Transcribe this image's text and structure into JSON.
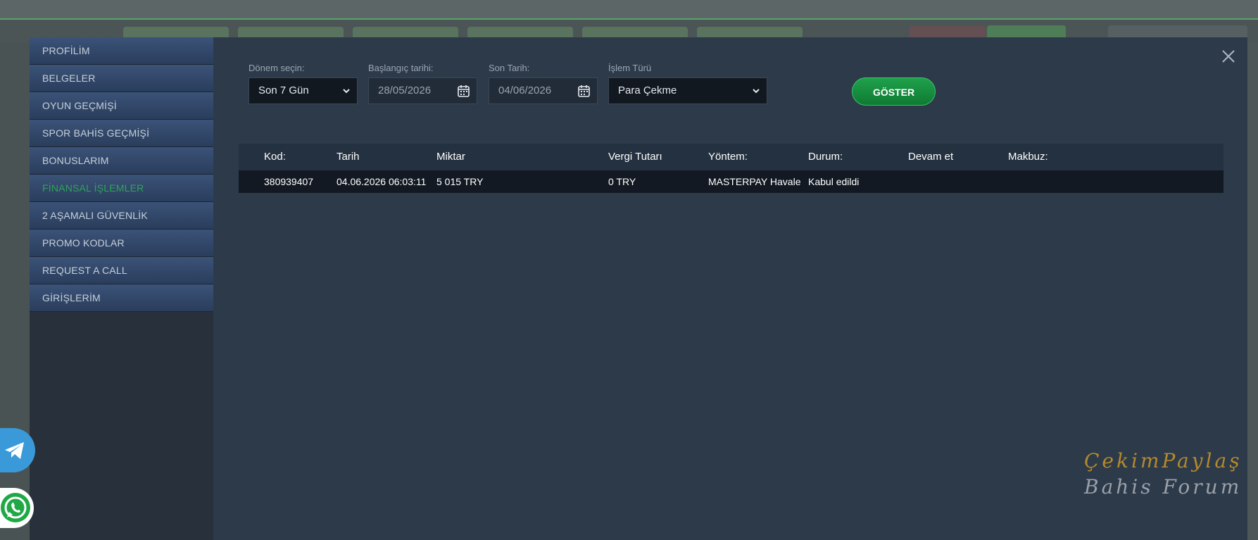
{
  "menu": {
    "items": [
      {
        "label": "PROFİLİM",
        "active": false
      },
      {
        "label": "BELGELER",
        "active": false
      },
      {
        "label": "OYUN GEÇMİŞİ",
        "active": false
      },
      {
        "label": "SPOR BAHİS GEÇMİŞİ",
        "active": false
      },
      {
        "label": "BONUSLARIM",
        "active": false
      },
      {
        "label": "FİNANSAL İŞLEMLER",
        "active": true
      },
      {
        "label": "2 AŞAMALI GÜVENLİK",
        "active": false
      },
      {
        "label": "PROMO KODLAR",
        "active": false
      },
      {
        "label": "REQUEST A CALL",
        "active": false
      },
      {
        "label": "GİRİŞLERİM",
        "active": false
      }
    ]
  },
  "filters": {
    "period_label": "Dönem seçin:",
    "period_value": "Son 7 Gün",
    "start_label": "Başlangıç tarihi:",
    "start_value": "28/05/2026",
    "end_label": "Son Tarih:",
    "end_value": "04/06/2026",
    "type_label": "İşlem Türü",
    "type_value": "Para Çekme",
    "show_button": "GÖSTER"
  },
  "table": {
    "headers": [
      "Kod:",
      "Tarih",
      "Miktar",
      "Vergi Tutarı",
      "Yöntem:",
      "Durum:",
      "Devam et",
      "Makbuz:"
    ],
    "rows": [
      [
        "380939407",
        "04.06.2026 06:03:11",
        "5 015 TRY",
        "0 TRY",
        "MASTERPAY Havale",
        "Kabul edildi",
        "",
        ""
      ]
    ]
  },
  "watermark": {
    "line1": "ÇekimPaylaş",
    "line2": "Bahis Forum"
  },
  "colors": {
    "active_menu": "#2fa25a",
    "button_green": "#1fa14b",
    "modal_bg": "#2d3a4a"
  }
}
